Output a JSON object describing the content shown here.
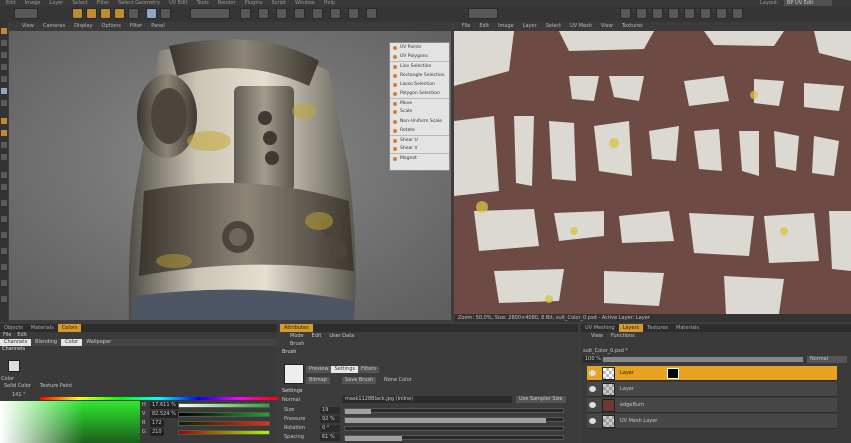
{
  "menubar": {
    "items": [
      "Edit",
      "Image",
      "Layer",
      "Select",
      "Filter",
      "Select Geometry",
      "UV Edit",
      "Tools",
      "Render",
      "Plugins",
      "Script",
      "Window",
      "Help"
    ],
    "layout_label": "Layout:",
    "layout_value": "BP UV Edit"
  },
  "viewport": {
    "menu": [
      "View",
      "Cameras",
      "Display",
      "Options",
      "Filter",
      "Panel"
    ]
  },
  "uv_editor": {
    "menu": [
      "File",
      "Edit",
      "Image",
      "Layer",
      "Select",
      "UV Mesh",
      "View",
      "Textures"
    ],
    "status": "Zoom: 50.0%, Size: 2800×4080, 8 Bit, suit_Color_0.psd - Active Layer: Layer"
  },
  "context_menu": {
    "items": [
      "UV Points",
      "UV Polygons",
      "Live Selection",
      "Rectangle Selection",
      "Lasso Selection",
      "Polygon Selection",
      "Move",
      "Scale",
      "Non-Uniform Scale",
      "Rotate",
      "Shear U",
      "Shear V",
      "Magnet"
    ]
  },
  "left_panel": {
    "tabs": [
      "Objects",
      "Materials",
      "Colors"
    ],
    "file_menu": [
      "File",
      "Edit"
    ],
    "subtabs": [
      "Channels",
      "Blending",
      "Color",
      "Wallpaper"
    ],
    "section": "Channels",
    "color_label": "Color",
    "solid_color": "Solid Color",
    "texture_paint": "Texture Paint",
    "color_value": "141 °",
    "hsv": [
      {
        "label": "H",
        "value": "17.611 %"
      },
      {
        "label": "V",
        "value": "82.524 %"
      },
      {
        "label": "R",
        "value": "172"
      },
      {
        "label": "G",
        "value": "210"
      }
    ]
  },
  "attributes": {
    "tab": "Attributes",
    "menu": [
      "Mode",
      "Edit",
      "User Data"
    ],
    "breadcrumb": "Brush",
    "section_brush": "Brush",
    "brush_tabs": [
      "Preview",
      "Settings",
      "Filters"
    ],
    "bitmap_label": "Bitmap",
    "save_brush": "Save Brush",
    "none_color": "None Color",
    "settings_label": "Settings",
    "normal_label": "Normal",
    "normal_value": "mask1128Black.jpg (Inline)",
    "use_sampler": "Use Sampler Size",
    "params": [
      {
        "label": "Size",
        "value": "19",
        "fill": 0.12
      },
      {
        "label": "Pressure",
        "value": "92 %",
        "fill": 0.92
      },
      {
        "label": "Rotation",
        "value": "0 °",
        "fill": 0.0
      },
      {
        "label": "Spacing",
        "value": "61 %",
        "fill": 0.26
      }
    ]
  },
  "layers_panel": {
    "tabs": [
      "UV Meshing",
      "Layers",
      "Textures",
      "Materials"
    ],
    "menu": [
      "View",
      "Functions"
    ],
    "file": "suit_Color_0.psd *",
    "opacity": "100 %",
    "blend_mode": "Normal",
    "layers": [
      {
        "name": "Layer",
        "active": true
      },
      {
        "name": "Layer",
        "active": false
      },
      {
        "name": "edgeBurn",
        "active": false
      },
      {
        "name": "UV Mesh Layer",
        "active": false
      }
    ]
  },
  "colors": {
    "accent": "#d49a2c",
    "uv_bg": "#6e4a44",
    "viewport_bg": "#777777"
  }
}
